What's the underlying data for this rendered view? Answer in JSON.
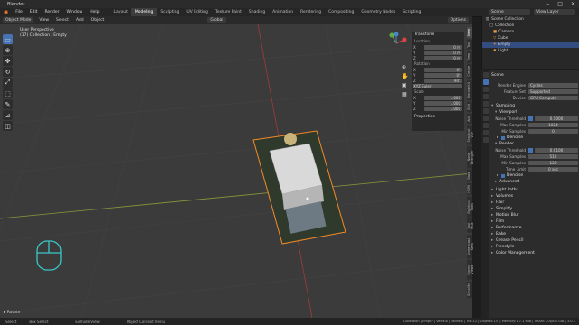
{
  "window": {
    "title": "Blender",
    "controls": [
      "–",
      "□",
      "✕"
    ]
  },
  "menubar": {
    "menus": [
      "File",
      "Edit",
      "Render",
      "Window",
      "Help"
    ],
    "workspaces": [
      "Layout",
      "Modeling",
      "Sculpting",
      "UV Editing",
      "Texture Paint",
      "Shading",
      "Animation",
      "Rendering",
      "Compositing",
      "Geometry Nodes",
      "Scripting"
    ],
    "active_workspace": "Modeling",
    "scene_label": "Scene",
    "view_layer_label": "View Layer"
  },
  "tool_header": {
    "mode": "Object Mode",
    "menus": [
      "View",
      "Select",
      "Add",
      "Object"
    ],
    "orientation": "Global",
    "options_label": "Options"
  },
  "viewport": {
    "overlay_line1": "User Perspective",
    "overlay_line2": "(17) Collection | Empty",
    "footer_label": "Rotate"
  },
  "n_panel": {
    "transform_header": "Transform",
    "location_header": "Location",
    "location": [
      {
        "axis": "X",
        "value": "0 m"
      },
      {
        "axis": "Y",
        "value": "0 m"
      },
      {
        "axis": "Z",
        "value": "0 m"
      }
    ],
    "rotation_header": "Rotation",
    "rotation": [
      {
        "axis": "X",
        "value": "0°"
      },
      {
        "axis": "Y",
        "value": "0°"
      },
      {
        "axis": "Z",
        "value": "90°"
      }
    ],
    "rotation_mode": "XYZ Euler",
    "scale_header": "Scale",
    "scale": [
      {
        "axis": "X",
        "value": "1.000"
      },
      {
        "axis": "Y",
        "value": "1.000"
      },
      {
        "axis": "Z",
        "value": "1.000"
      }
    ],
    "properties_header": "Properties"
  },
  "vertical_tabs": [
    "Item",
    "Tool",
    "View",
    "Create",
    "BlenderKit",
    "Edit",
    "Add",
    "Shortcut VUr",
    "Node Wrangler",
    "Bake",
    "HDRI",
    "Building Tools",
    "Tool Plus",
    "Screencast Keys",
    "Stored Views",
    "Simplify"
  ],
  "outliner": {
    "rows": [
      {
        "label": "Scene Collection",
        "selected": false
      },
      {
        "label": "Collection",
        "selected": false
      },
      {
        "label": "Camera",
        "selected": false
      },
      {
        "label": "Cube",
        "selected": false
      },
      {
        "label": "Empty",
        "selected": true
      },
      {
        "label": "Light",
        "selected": false
      }
    ]
  },
  "properties": {
    "scene_label": "Scene",
    "render_engine_label": "Render Engine",
    "render_engine": "Cycles",
    "feature_set_label": "Feature Set",
    "feature_set": "Supported",
    "device_label": "Device",
    "device": "GPU Compute",
    "sampling": "Sampling",
    "viewport": "Viewport",
    "noise_threshold_label": "Noise Threshold",
    "vp_noise": "0.1000",
    "max_samples_label": "Max Samples",
    "vp_max": "1024",
    "min_samples_label": "Min Samples",
    "vp_min": "0",
    "denoise": "Denoise",
    "render": "Render",
    "r_noise": "0.0100",
    "r_max": "512",
    "r_min": "128",
    "time_limit_label": "Time Limit",
    "time_limit": "0 sec",
    "advanced": "Advanced",
    "sections": [
      "Light Paths",
      "Volumes",
      "Hair",
      "Simplify",
      "Motion Blur",
      "Film",
      "Performance",
      "Bake",
      "Grease Pencil",
      "Freestyle",
      "Color Management"
    ]
  },
  "statusbar": {
    "left": [
      "Select",
      "Box Select",
      "Extrude View",
      "Object Context Menu"
    ],
    "right": "Collection | Empty | Verts:8 | Faces:6 | Tris:12 | Objects:1/4 | Memory: 17.1 MiB | VRAM: 0.4/8.0 GiB | 3.0.1"
  },
  "colors": {
    "accent": "#4772b3",
    "outline": "#f28a28",
    "grid": "#3b3b3b"
  }
}
